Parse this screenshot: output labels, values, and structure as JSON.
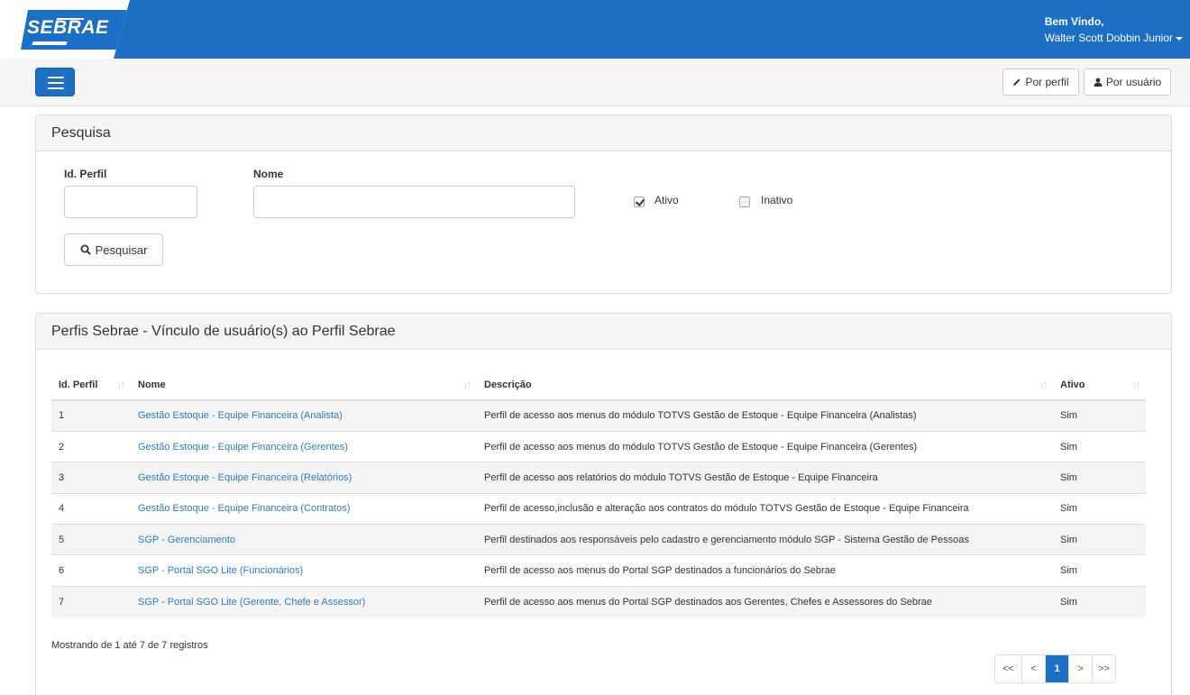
{
  "header": {
    "logo_text": "SEBRAE",
    "welcome_line1": "Bem Vindo,",
    "welcome_line2": "Walter Scott Dobbin Junior"
  },
  "toolbar": {
    "btn_por_perfil": "Por perfil",
    "btn_por_usuario": "Por usuário"
  },
  "search_panel": {
    "title": "Pesquisa",
    "id_label": "Id. Perfil",
    "nome_label": "Nome",
    "id_value": "",
    "nome_value": "",
    "ativo_label": "Ativo",
    "ativo_checked": true,
    "inativo_label": "Inativo",
    "inativo_checked": false,
    "search_button": "Pesquisar"
  },
  "results_panel": {
    "title": "Perfis Sebrae - Vínculo de usuário(s) ao Perfil Sebrae",
    "columns": [
      "Id. Perfil",
      "Nome",
      "Descrição",
      "Ativo"
    ],
    "rows": [
      {
        "id": "1",
        "nome": "Gestão Estoque - Equipe Financeira (Analista)",
        "descricao": "Perfil de acesso aos menus do módulo TOTVS Gestão de Estoque - Equipe Financeira (Analistas)",
        "ativo": "Sim"
      },
      {
        "id": "2",
        "nome": "Gestão Estoque - Equipe Financeira (Gerentes)",
        "descricao": "Perfil de acesso aos menus do módulo TOTVS Gestão de Estoque - Equipe Financeira (Gerentes)",
        "ativo": "Sim"
      },
      {
        "id": "3",
        "nome": "Gestão Estoque - Equipe Financeira (Relatórios)",
        "descricao": "Perfil de acesso aos relatórios do módulo TOTVS Gestão de Estoque - Equipe Financeira",
        "ativo": "Sim"
      },
      {
        "id": "4",
        "nome": "Gestão Estoque - Equipe Financeira (Contratos)",
        "descricao": "Perfil de acesso,inclusão e alteração aos contratos do módulo TOTVS Gestão de Estoque - Equipe Financeira",
        "ativo": "Sim"
      },
      {
        "id": "5",
        "nome": "SGP - Gerenciamento",
        "descricao": "Perfil destinados aos responsáveis pelo cadastro e gerenciamento módulo SGP - Sistema Gestão de Pessoas",
        "ativo": "Sim"
      },
      {
        "id": "6",
        "nome": "SGP - Portal SGO Lite (Funcionários)",
        "descricao": "Perfil de acesso aos menus do Portal SGP destinados a funcionários do Sebrae",
        "ativo": "Sim"
      },
      {
        "id": "7",
        "nome": "SGP - Portal SGO Lite (Gerente, Chefe e Assessor)",
        "descricao": "Perfil de acesso aos menus do Portal SGP destinados aos Gerentes, Chefes e Assessores do Sebrae",
        "ativo": "Sim"
      }
    ],
    "info": "Mostrando de 1 até 7 de 7 registros",
    "pagination": {
      "first": "<<",
      "prev": "<",
      "current": "1",
      "next": ">",
      "last": ">>"
    }
  },
  "icons": {
    "menu": "hamburger-icon",
    "pencil": "pencil-icon",
    "user": "user-icon",
    "search": "search-icon",
    "sort": "sort-icon"
  },
  "colors": {
    "brand": "#1c6fc4",
    "link": "#337ab7"
  }
}
